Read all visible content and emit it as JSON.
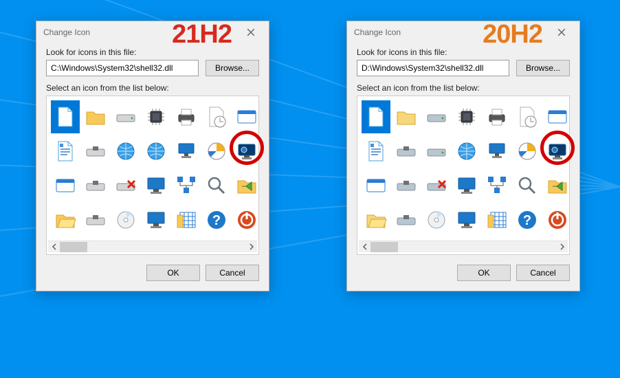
{
  "dialogs": [
    {
      "title": "Change Icon",
      "version_label": "21H2",
      "version_color": "#d62a1e",
      "close_symbol": "×",
      "look_for_label": "Look for icons in this file:",
      "path_value": "C:\\Windows\\System32\\shell32.dll",
      "browse_label": "Browse...",
      "select_label": "Select an icon from the list below:",
      "ok_label": "OK",
      "cancel_label": "Cancel",
      "icons": [
        "blank-file",
        "folder",
        "drive",
        "chip",
        "printer",
        "recent-doc",
        "run-dialog",
        "text-doc",
        "floppy-drive",
        "globe-1",
        "globe-2",
        "network-pc",
        "settings-icon",
        "screensaver",
        "app-window",
        "floppy-2",
        "drive-error",
        "monitor-check",
        "network",
        "search",
        "folder-back",
        "folder-open",
        "floppy-save",
        "cd",
        "monitor",
        "grid",
        "help",
        "power"
      ],
      "selected_index": 0
    },
    {
      "title": "Change Icon",
      "version_label": "20H2",
      "version_color": "#e57c1f",
      "close_symbol": "×",
      "look_for_label": "Look for icons in this file:",
      "path_value": "D:\\Windows\\System32\\shell32.dll",
      "browse_label": "Browse...",
      "select_label": "Select an icon from the list below:",
      "ok_label": "OK",
      "cancel_label": "Cancel",
      "icons": [
        "blank-file",
        "folder",
        "drive",
        "chip",
        "printer",
        "recent-doc",
        "run-dialog",
        "text-doc",
        "floppy-drive",
        "drive-2",
        "globe-2",
        "network-pc",
        "settings-icon",
        "screensaver",
        "app-window",
        "floppy-2",
        "drive-error",
        "monitor-check",
        "network",
        "search",
        "folder-back",
        "folder-open",
        "floppy-save",
        "cd",
        "monitor",
        "grid",
        "help",
        "power"
      ],
      "selected_index": 0
    }
  ]
}
